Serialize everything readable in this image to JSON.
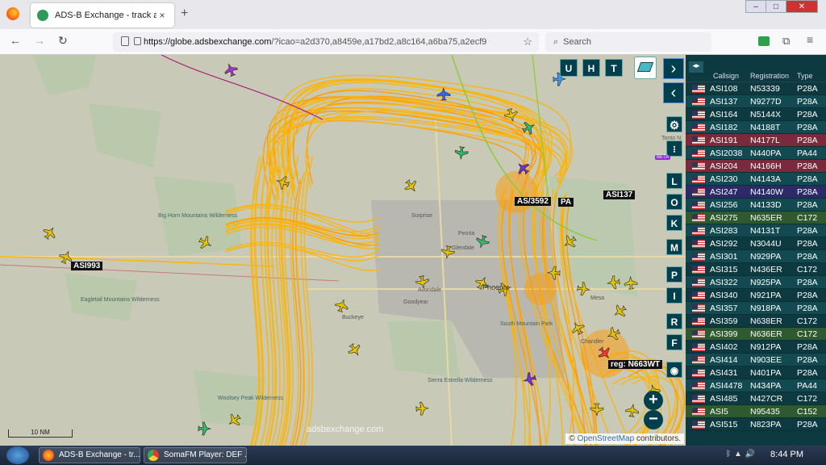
{
  "browser": {
    "tab_title": "ADS-B Exchange - track aircraft",
    "tab_close": "×",
    "new_tab": "+",
    "url_domain": "https://globe.adsbexchange.com",
    "url_rest": "/?icao=a2d370,a8459e,a17bd2,a8c164,a6ba75,a2ecf9",
    "search_placeholder": "Search",
    "back": "←",
    "forward": "→",
    "reload": "↻",
    "window_controls": [
      "–",
      "□",
      "✕"
    ]
  },
  "map": {
    "header_buttons": [
      "U",
      "H",
      "T"
    ],
    "side_buttons": [
      "L",
      "O",
      "K",
      "M",
      "P",
      "I",
      "R",
      "F"
    ],
    "beta_label": "BETA",
    "zoom_in": "+",
    "zoom_out": "−",
    "scale_label": "10 NM",
    "watermark": "adsbexchange.com",
    "attribution_prefix": "©",
    "attribution_osm": "OpenStreetMap",
    "attribution_suffix": "contributors.",
    "aircraft_labels": [
      {
        "text": "ASI993"
      },
      {
        "text": "ASI137"
      },
      {
        "text": "AS/3592"
      },
      {
        "text": "PA"
      },
      {
        "text": "reg: N663WT"
      }
    ],
    "place_names": [
      "Surprise",
      "Peoria",
      "Glendale",
      "Avondale",
      "Goodyear",
      "Phoenix",
      "Buckeye",
      "Mesa",
      "Chandler",
      "Big Horn Mountains Wilderness",
      "Eagletail Mountains Wilderness",
      "Woolsey Peak Wilderness",
      "Sierra Estrella Wilderness",
      "South Mountain Park",
      "Tonto N"
    ],
    "colors": {
      "tracks": "#ffb400",
      "tracks_dense": "#ff9a00",
      "green_track": "#88cc33",
      "purple_track": "#aa2277",
      "map_bg": "#c9c9b8",
      "urban": "#b8b8b0"
    }
  },
  "panel": {
    "expand_icon": "◂▸",
    "columns": [
      "Callsign",
      "Registration",
      "Type"
    ],
    "rows": [
      {
        "callsign": "ASI108",
        "registration": "N53339",
        "type": "P28A"
      },
      {
        "callsign": "ASI137",
        "registration": "N9277D",
        "type": "P28A"
      },
      {
        "callsign": "ASI164",
        "registration": "N5144X",
        "type": "P28A"
      },
      {
        "callsign": "ASI182",
        "registration": "N4188T",
        "type": "P28A"
      },
      {
        "callsign": "ASI191",
        "registration": "N4177L",
        "type": "P28A"
      },
      {
        "callsign": "ASI2038",
        "registration": "N440PA",
        "type": "PA44"
      },
      {
        "callsign": "ASI204",
        "registration": "N4166H",
        "type": "P28A"
      },
      {
        "callsign": "ASI230",
        "registration": "N4143A",
        "type": "P28A"
      },
      {
        "callsign": "ASI247",
        "registration": "N4140W",
        "type": "P28A"
      },
      {
        "callsign": "ASI256",
        "registration": "N4133D",
        "type": "P28A"
      },
      {
        "callsign": "ASI275",
        "registration": "N635ER",
        "type": "C172"
      },
      {
        "callsign": "ASI283",
        "registration": "N4131T",
        "type": "P28A"
      },
      {
        "callsign": "ASI292",
        "registration": "N3044U",
        "type": "P28A"
      },
      {
        "callsign": "ASI301",
        "registration": "N929PA",
        "type": "P28A"
      },
      {
        "callsign": "ASI315",
        "registration": "N436ER",
        "type": "C172"
      },
      {
        "callsign": "ASI322",
        "registration": "N925PA",
        "type": "P28A"
      },
      {
        "callsign": "ASI340",
        "registration": "N921PA",
        "type": "P28A"
      },
      {
        "callsign": "ASI357",
        "registration": "N918PA",
        "type": "P28A"
      },
      {
        "callsign": "ASI359",
        "registration": "N638ER",
        "type": "C172"
      },
      {
        "callsign": "ASI399",
        "registration": "N636ER",
        "type": "C172"
      },
      {
        "callsign": "ASI402",
        "registration": "N912PA",
        "type": "P28A"
      },
      {
        "callsign": "ASI414",
        "registration": "N903EE",
        "type": "P28A"
      },
      {
        "callsign": "ASI431",
        "registration": "N401PA",
        "type": "P28A"
      },
      {
        "callsign": "ASI4478",
        "registration": "N434PA",
        "type": "PA44"
      },
      {
        "callsign": "ASI485",
        "registration": "N427CR",
        "type": "C172"
      },
      {
        "callsign": "ASI5",
        "registration": "N95435",
        "type": "C152"
      },
      {
        "callsign": "ASI515",
        "registration": "N823PA",
        "type": "P28A"
      }
    ]
  },
  "taskbar": {
    "items": [
      "ADS-B Exchange - tr...",
      "SomaFM Player: DEF ..."
    ],
    "clock": "8:44 PM"
  }
}
